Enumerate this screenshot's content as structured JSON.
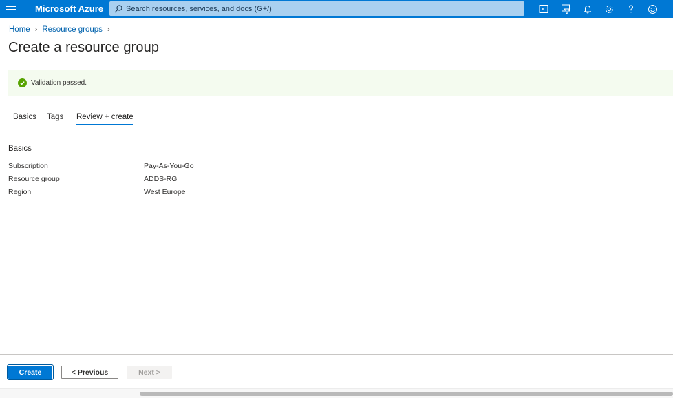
{
  "app": {
    "brand": "Microsoft Azure"
  },
  "search": {
    "placeholder": "Search resources, services, and docs (G+/)"
  },
  "topbar_icons": [
    "cloud-shell-icon",
    "directory-filter-icon",
    "notifications-bell-icon",
    "settings-gear-icon",
    "help-question-icon",
    "feedback-smiley-icon"
  ],
  "breadcrumb": {
    "home": "Home",
    "resource_groups": "Resource groups"
  },
  "page": {
    "title": "Create a resource group"
  },
  "validation": {
    "message": "Validation passed.",
    "status_color": "#57a300"
  },
  "tabs": [
    {
      "label": "Basics"
    },
    {
      "label": "Tags"
    },
    {
      "label": "Review + create"
    }
  ],
  "summary": {
    "section_title": "Basics",
    "rows": [
      {
        "label": "Subscription",
        "value": "Pay-As-You-Go"
      },
      {
        "label": "Resource group",
        "value": "ADDS-RG"
      },
      {
        "label": "Region",
        "value": "West Europe"
      }
    ]
  },
  "footer": {
    "create_label": "Create",
    "previous_label": "< Previous",
    "next_label": "Next >"
  },
  "colors": {
    "accent": "#0078d4"
  }
}
